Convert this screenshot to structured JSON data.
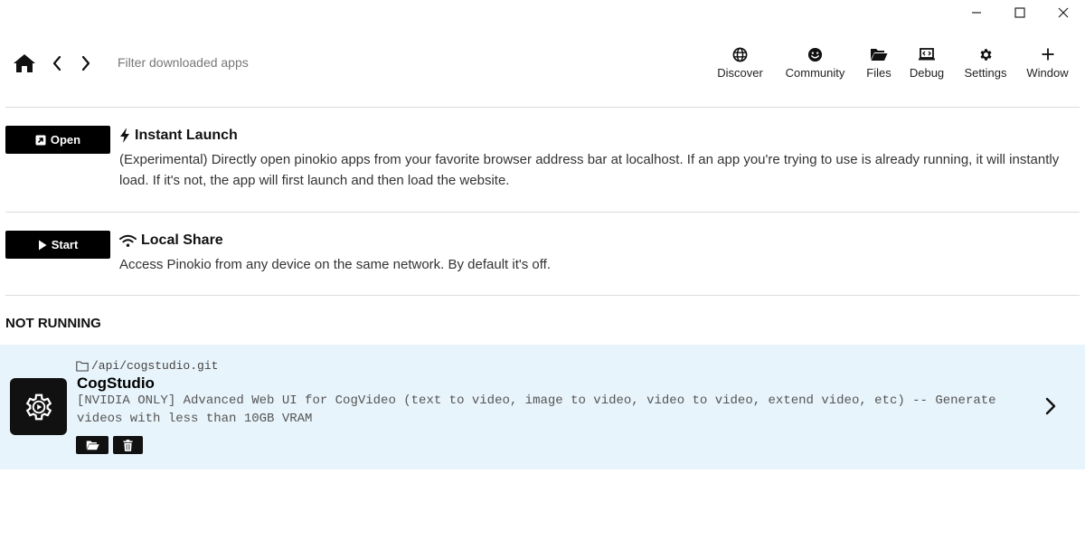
{
  "window_controls": {
    "minimize_icon": "minimize-icon",
    "maximize_icon": "maximize-icon",
    "close_icon": "close-icon"
  },
  "header": {
    "search": {
      "placeholder": "Filter downloaded apps",
      "value": ""
    },
    "nav": [
      {
        "label": "Discover",
        "icon": "globe-icon"
      },
      {
        "label": "Community",
        "icon": "smile-icon"
      },
      {
        "label": "Files",
        "icon": "folder-open-icon"
      },
      {
        "label": "Debug",
        "icon": "laptop-code-icon"
      },
      {
        "label": "Settings",
        "icon": "gear-icon"
      },
      {
        "label": "Window",
        "icon": "plus-icon"
      }
    ]
  },
  "features": [
    {
      "button_label": "Open",
      "button_icon": "square-arrow-up-right-icon",
      "title": "Instant Launch",
      "title_icon": "bolt-icon",
      "description": "(Experimental) Directly open pinokio apps from your favorite browser address bar at localhost. If an app you're trying to use is already running, it will instantly load. If it's not, the app will first launch and then load the website."
    },
    {
      "button_label": "Start",
      "button_icon": "play-icon",
      "title": "Local Share",
      "title_icon": "wifi-icon",
      "description": "Access Pinokio from any device on the same network. By default it's off."
    }
  ],
  "not_running": {
    "heading": "NOT RUNNING",
    "apps": [
      {
        "path": "/api/cogstudio.git",
        "title": "CogStudio",
        "description": "[NVIDIA ONLY] Advanced Web UI for CogVideo (text to video, image to video, video to video, extend video, etc) -- Generate videos with less than 10GB VRAM",
        "icon": "gear-play-icon",
        "actions": [
          "folder-open-icon",
          "trash-icon"
        ]
      }
    ]
  },
  "colors": {
    "button_bg": "#000000",
    "card_bg": "#e8f4fb",
    "divider": "#dcdcdc"
  }
}
